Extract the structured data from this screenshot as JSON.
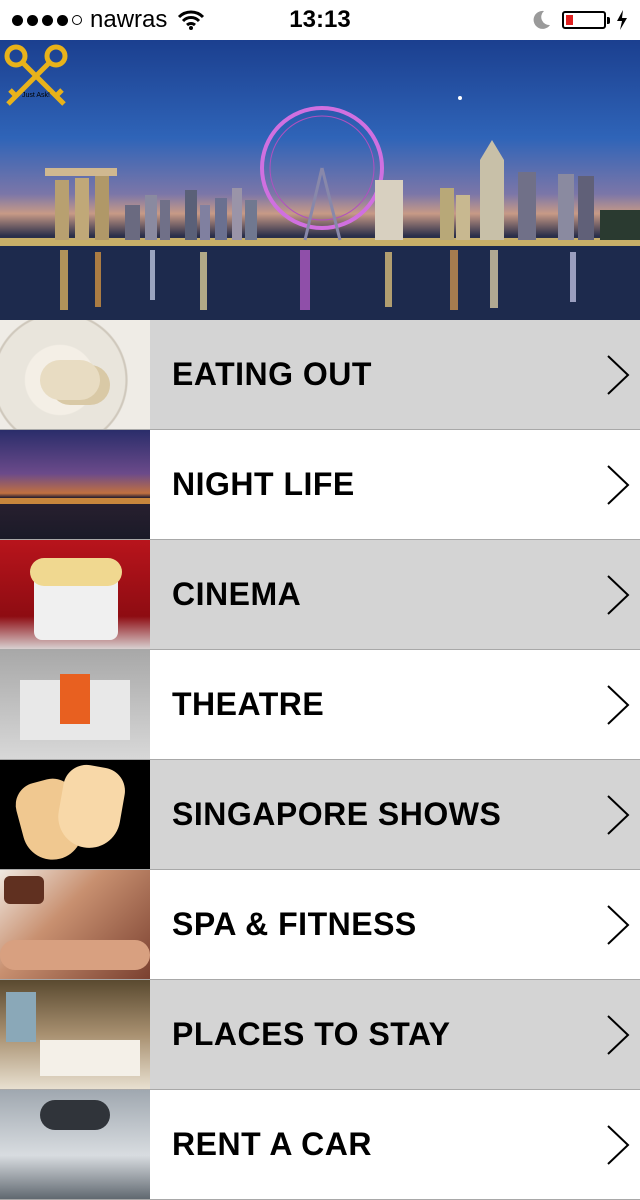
{
  "status_bar": {
    "carrier": "nawras",
    "time": "13:13",
    "battery_level": 0.2
  },
  "hero": {
    "logo_text": "Just Ask!"
  },
  "menu": {
    "items": [
      {
        "label": "EATING OUT",
        "icon": "chevron-right-icon"
      },
      {
        "label": "NIGHT LIFE",
        "icon": "chevron-right-icon"
      },
      {
        "label": "CINEMA",
        "icon": "chevron-right-icon"
      },
      {
        "label": "THEATRE",
        "icon": "chevron-right-icon"
      },
      {
        "label": "SINGAPORE SHOWS",
        "icon": "chevron-right-icon"
      },
      {
        "label": "SPA & FITNESS",
        "icon": "chevron-right-icon"
      },
      {
        "label": "PLACES TO STAY",
        "icon": "chevron-right-icon"
      },
      {
        "label": "RENT A CAR",
        "icon": "chevron-right-icon"
      }
    ]
  },
  "colors": {
    "row_gray": "#d4d4d4",
    "row_white": "#ffffff",
    "battery_low": "#e02020",
    "logo_gold": "#e8b21a"
  }
}
